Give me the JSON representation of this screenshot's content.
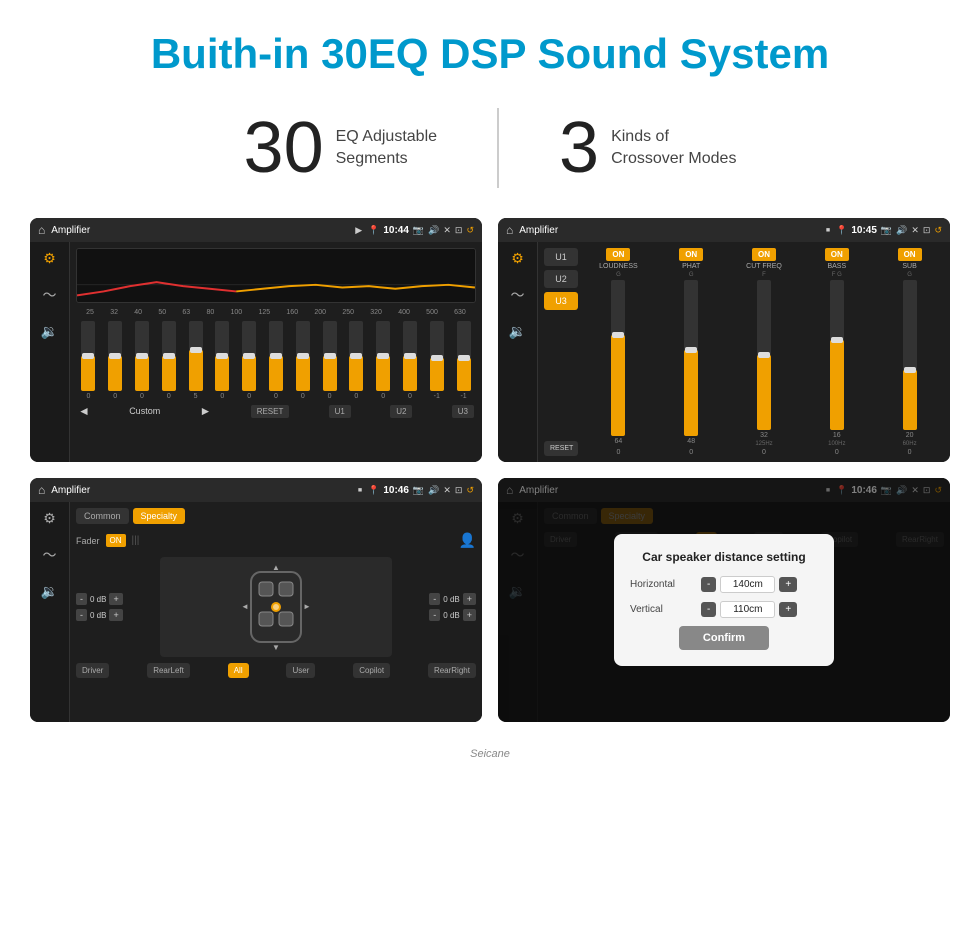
{
  "header": {
    "title": "Buith-in 30EQ DSP Sound System"
  },
  "stats": {
    "eq_number": "30",
    "eq_label_line1": "EQ Adjustable",
    "eq_label_line2": "Segments",
    "crossover_number": "3",
    "crossover_label_line1": "Kinds of",
    "crossover_label_line2": "Crossover Modes"
  },
  "screen1": {
    "title": "Amplifier",
    "time": "10:44",
    "freq_labels": [
      "25",
      "32",
      "40",
      "50",
      "63",
      "80",
      "100",
      "125",
      "160",
      "200",
      "250",
      "320",
      "400",
      "500",
      "630"
    ],
    "slider_values": [
      "0",
      "0",
      "0",
      "0",
      "5",
      "0",
      "0",
      "0",
      "0",
      "0",
      "0",
      "0",
      "0",
      "-1",
      "0",
      "-1"
    ],
    "slider_heights": [
      50,
      50,
      50,
      52,
      58,
      50,
      50,
      50,
      50,
      50,
      50,
      50,
      50,
      46,
      50,
      46
    ],
    "bottom_label": "Custom",
    "buttons": [
      "RESET",
      "U1",
      "U2",
      "U3"
    ]
  },
  "screen2": {
    "title": "Amplifier",
    "time": "10:45",
    "presets": [
      "U1",
      "U2",
      "U3"
    ],
    "active_preset": "U3",
    "channels": [
      {
        "name": "LOUDNESS",
        "on": true,
        "heights": [
          70,
          30
        ]
      },
      {
        "name": "PHAT",
        "on": true,
        "heights": [
          60,
          25
        ]
      },
      {
        "name": "CUT FREQ",
        "on": true,
        "heights": [
          55,
          20
        ]
      },
      {
        "name": "BASS",
        "on": true,
        "heights": [
          65,
          28
        ]
      },
      {
        "name": "SUB",
        "on": true,
        "heights": [
          40,
          22
        ]
      }
    ],
    "reset_label": "RESET"
  },
  "screen3": {
    "title": "Amplifier",
    "time": "10:46",
    "tabs": [
      "Common",
      "Specialty"
    ],
    "active_tab": "Specialty",
    "fader_label": "Fader",
    "fader_on": "ON",
    "vol_left_top": "0 dB",
    "vol_left_bottom": "0 dB",
    "vol_right_top": "0 dB",
    "vol_right_bottom": "0 dB",
    "buttons": [
      "Driver",
      "RearLeft",
      "All",
      "User",
      "Copilot",
      "RearRight"
    ],
    "active_btn": "All"
  },
  "screen4": {
    "title": "Amplifier",
    "time": "10:46",
    "tabs": [
      "Common",
      "Specialty"
    ],
    "active_tab": "Specialty",
    "dialog": {
      "title": "Car speaker distance setting",
      "horizontal_label": "Horizontal",
      "horizontal_value": "140cm",
      "vertical_label": "Vertical",
      "vertical_value": "110cm",
      "confirm_label": "Confirm"
    },
    "buttons": [
      "Driver",
      "RearLeft",
      "All",
      "User",
      "Copilot",
      "RearRight"
    ]
  },
  "watermark": "Seicane"
}
